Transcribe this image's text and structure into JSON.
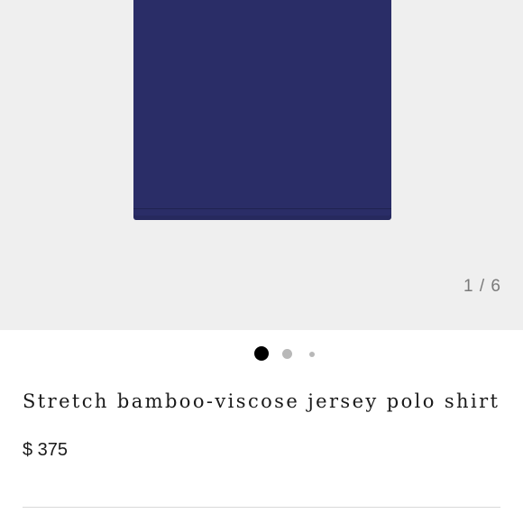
{
  "gallery": {
    "counter": "1 / 6",
    "dots": [
      {
        "state": "active"
      },
      {
        "state": "inactive"
      },
      {
        "state": "inactive"
      }
    ],
    "shirt_color": "#2a2d67",
    "background_color": "#efefef",
    "icon": "product-image"
  },
  "product": {
    "title": "Stretch bamboo-viscose jersey polo shirt",
    "price": "$ 375"
  }
}
